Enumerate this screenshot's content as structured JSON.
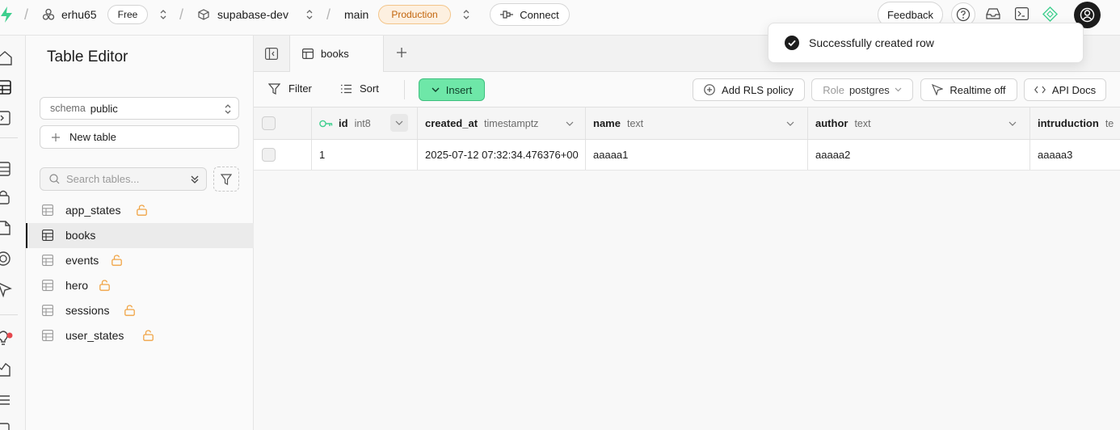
{
  "topbar": {
    "org": "erhu65",
    "plan": "Free",
    "project": "supabase-dev",
    "branch": "main",
    "env_badge": "Production",
    "connect_label": "Connect",
    "feedback_label": "Feedback"
  },
  "sidebar": {
    "title": "Table Editor",
    "schema_label": "schema",
    "schema_value": "public",
    "new_table_label": "New table",
    "search_placeholder": "Search tables...",
    "tables": [
      {
        "name": "app_states",
        "locked": true
      },
      {
        "name": "books",
        "locked": false,
        "active": true
      },
      {
        "name": "events",
        "locked": true
      },
      {
        "name": "hero",
        "locked": true
      },
      {
        "name": "sessions",
        "locked": true
      },
      {
        "name": "user_states",
        "locked": true
      }
    ]
  },
  "tabs": [
    {
      "label": "books"
    }
  ],
  "toolbar": {
    "filter_label": "Filter",
    "sort_label": "Sort",
    "insert_label": "Insert",
    "add_rls_label": "Add RLS policy",
    "role_prefix": "Role",
    "role_value": "postgres",
    "realtime_label": "Realtime off",
    "api_docs_label": "API Docs"
  },
  "grid": {
    "columns": [
      {
        "name": "id",
        "type": "int8",
        "primary_key": true
      },
      {
        "name": "created_at",
        "type": "timestamptz"
      },
      {
        "name": "name",
        "type": "text"
      },
      {
        "name": "author",
        "type": "text"
      },
      {
        "name": "intruduction",
        "type": "te"
      }
    ],
    "rows": [
      [
        "1",
        "2025-07-12 07:32:34.476376+00",
        "aaaaa1",
        "aaaaa2",
        "aaaaa3"
      ]
    ]
  },
  "toast": {
    "message": "Successfully created row"
  },
  "colors": {
    "brand": "#3ecf8e",
    "insert_bg": "#6ee7a8",
    "production": "#c2650c",
    "lock": "#f0a445"
  }
}
